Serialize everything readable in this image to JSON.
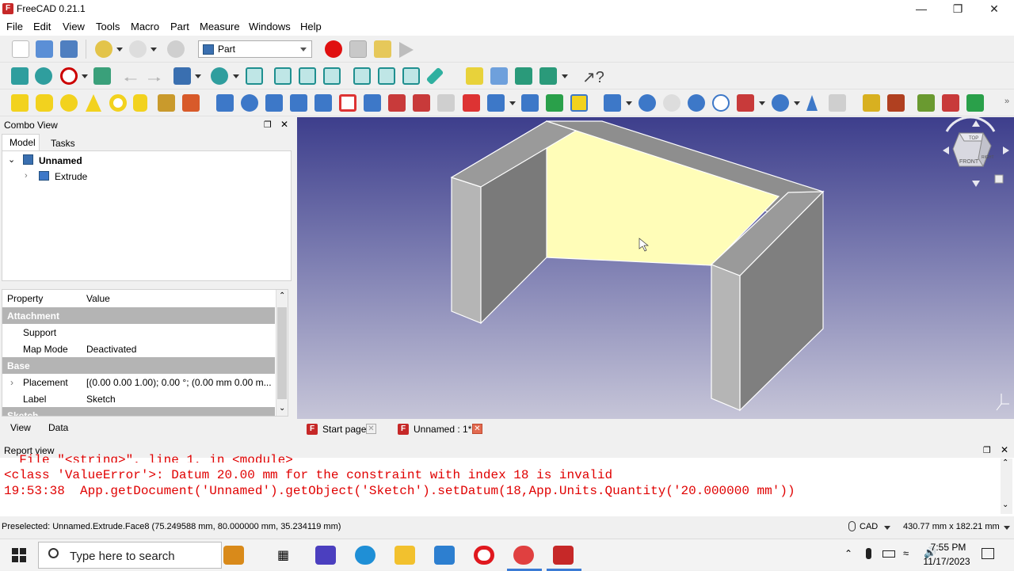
{
  "window": {
    "title": "FreeCAD 0.21.1",
    "app_icon_letter": "F"
  },
  "menu": [
    "File",
    "Edit",
    "View",
    "Tools",
    "Macro",
    "Part",
    "Measure",
    "Windows",
    "Help"
  ],
  "workbench": {
    "selected": "Part"
  },
  "combo_view": {
    "title": "Combo View",
    "tabs": [
      "Model",
      "Tasks"
    ],
    "tree": {
      "root": "Unnamed",
      "child": "Extrude"
    }
  },
  "properties": {
    "columns": [
      "Property",
      "Value"
    ],
    "rows": [
      {
        "type": "group",
        "name": "Attachment"
      },
      {
        "type": "row",
        "name": "Support",
        "value": ""
      },
      {
        "type": "row",
        "name": "Map Mode",
        "value": "Deactivated"
      },
      {
        "type": "group",
        "name": "Base"
      },
      {
        "type": "row",
        "name": "Placement",
        "value": "[(0.00 0.00 1.00); 0.00 °; (0.00 mm  0.00 m..."
      },
      {
        "type": "row",
        "name": "Label",
        "value": "Sketch"
      },
      {
        "type": "group",
        "name": "Sketch"
      }
    ],
    "bottom_tabs": [
      "View",
      "Data"
    ]
  },
  "navcube": {
    "top": "TOP",
    "front": "FRONT",
    "right": "RIGHT"
  },
  "doc_tabs": [
    "Start page",
    "Unnamed : 1*"
  ],
  "report_view": {
    "title": "Report view",
    "lines": [
      "  File \"<string>\", line 1, in <module>",
      "<class 'ValueError'>: Datum 20.00 mm for the constraint with index 18 is invalid",
      "19:53:38  App.getDocument('Unnamed').getObject('Sketch').setDatum(18,App.Units.Quantity('20.000000 mm'))"
    ]
  },
  "statusbar": {
    "preselected": "Preselected: Unnamed.Extrude.Face8 (75.249588 mm, 80.000000 mm, 35.234119 mm)",
    "nav_style": "CAD",
    "dimensions": "430.77 mm x 182.21 mm"
  },
  "taskbar": {
    "search_placeholder": "Type here to search",
    "time": "7:55 PM",
    "date": "11/17/2023"
  },
  "colors": {
    "face_highlight": "#fffdb8",
    "solid_gray": "#8c8c8c",
    "report_error": "#e00000"
  }
}
